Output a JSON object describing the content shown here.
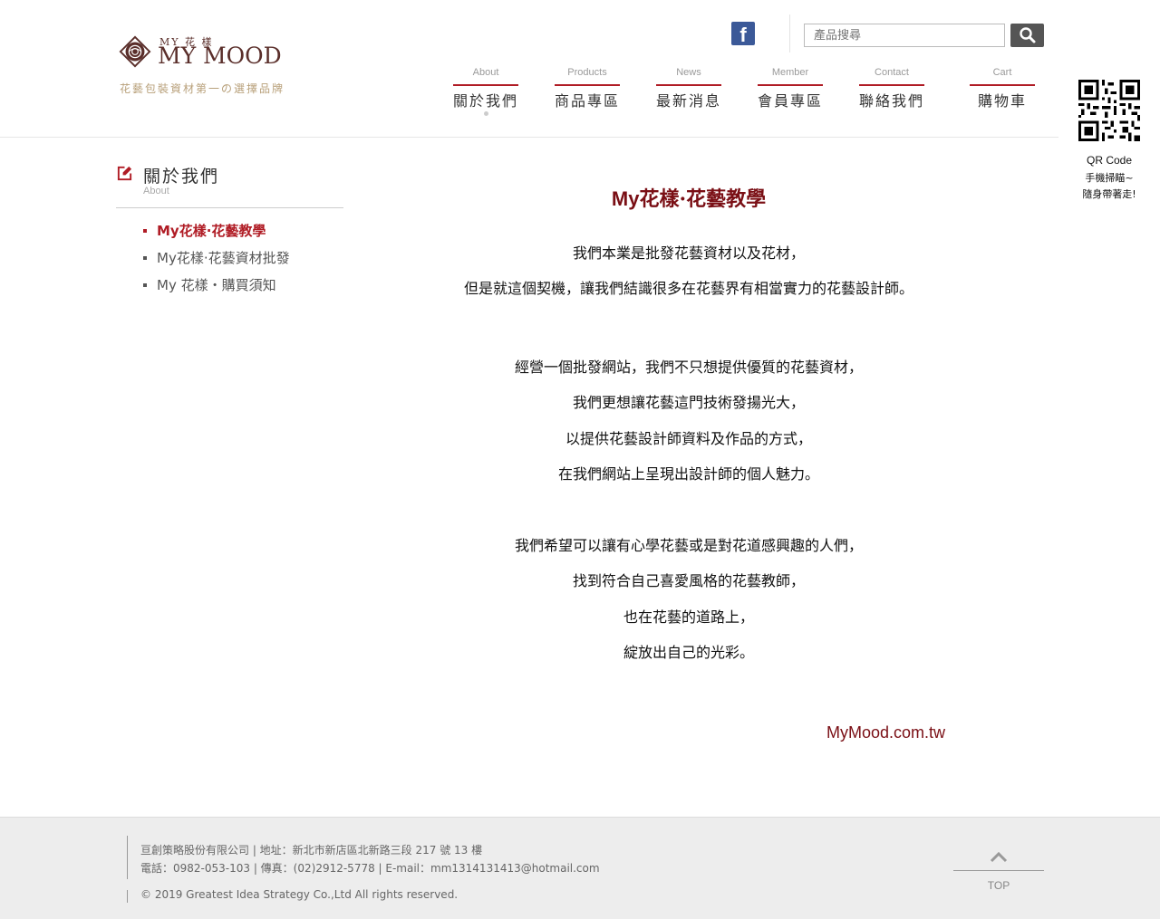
{
  "brand": {
    "small": "MY 花 樣",
    "name": "MY MOOD",
    "tagline": "花藝包裝資材第一の選擇品牌"
  },
  "header": {
    "facebook_icon": "facebook-icon",
    "search": {
      "placeholder": "產品搜尋",
      "icon": "search-icon"
    },
    "nav": [
      {
        "en": "About",
        "zh": "關於我們"
      },
      {
        "en": "Products",
        "zh": "商品專區"
      },
      {
        "en": "News",
        "zh": "最新消息"
      },
      {
        "en": "Member",
        "zh": "會員專區"
      },
      {
        "en": "Contact",
        "zh": "聯絡我們"
      },
      {
        "en": "Cart",
        "zh": "購物車"
      }
    ]
  },
  "qr": {
    "title": "QR Code",
    "line1": "手機掃瞄~",
    "line2": "隨身帶著走!"
  },
  "sidebar": {
    "title": "關於我們",
    "subtitle": "About",
    "items": [
      {
        "label": "My花樣·花藝教學",
        "active": true
      },
      {
        "label": "My花樣·花藝資材批發",
        "active": false
      },
      {
        "label": "My 花樣・購買須知",
        "active": false
      }
    ]
  },
  "main": {
    "title_ascii": "My",
    "title_rest": "花樣·花藝教學",
    "para1": [
      "我們本業是批發花藝資材以及花材，",
      "但是就這個契機，讓我們結識很多在花藝界有相當實力的花藝設計師。"
    ],
    "para2": [
      "經營一個批發網站，我們不只想提供優質的花藝資材，",
      "我們更想讓花藝這門技術發揚光大，",
      "以提供花藝設計師資料及作品的方式，",
      "在我們網站上呈現出設計師的個人魅力。"
    ],
    "para3": [
      "我們希望可以讓有心學花藝或是對花道感興趣的人們，",
      "找到符合自己喜愛風格的花藝教師，",
      "也在花藝的道路上，",
      "綻放出自己的光彩。"
    ],
    "site": "MyMood.com.tw"
  },
  "footer": {
    "line1": "亘創策略股份有限公司 | 地址：新北市新店區北新路三段 217 號 13 樓",
    "line2": "電話：0982-053-103 | 傳真：(02)2912-5778 | E-mail：mm1314131413@hotmail.com",
    "copyright": "© 2019 Greatest Idea Strategy Co.,Ltd All rights reserved.",
    "top_label": "TOP"
  },
  "colors": {
    "accent": "#b01c25",
    "title": "#7a0f15",
    "brand": "#5a2e2a",
    "tagline": "#b8a07a"
  }
}
